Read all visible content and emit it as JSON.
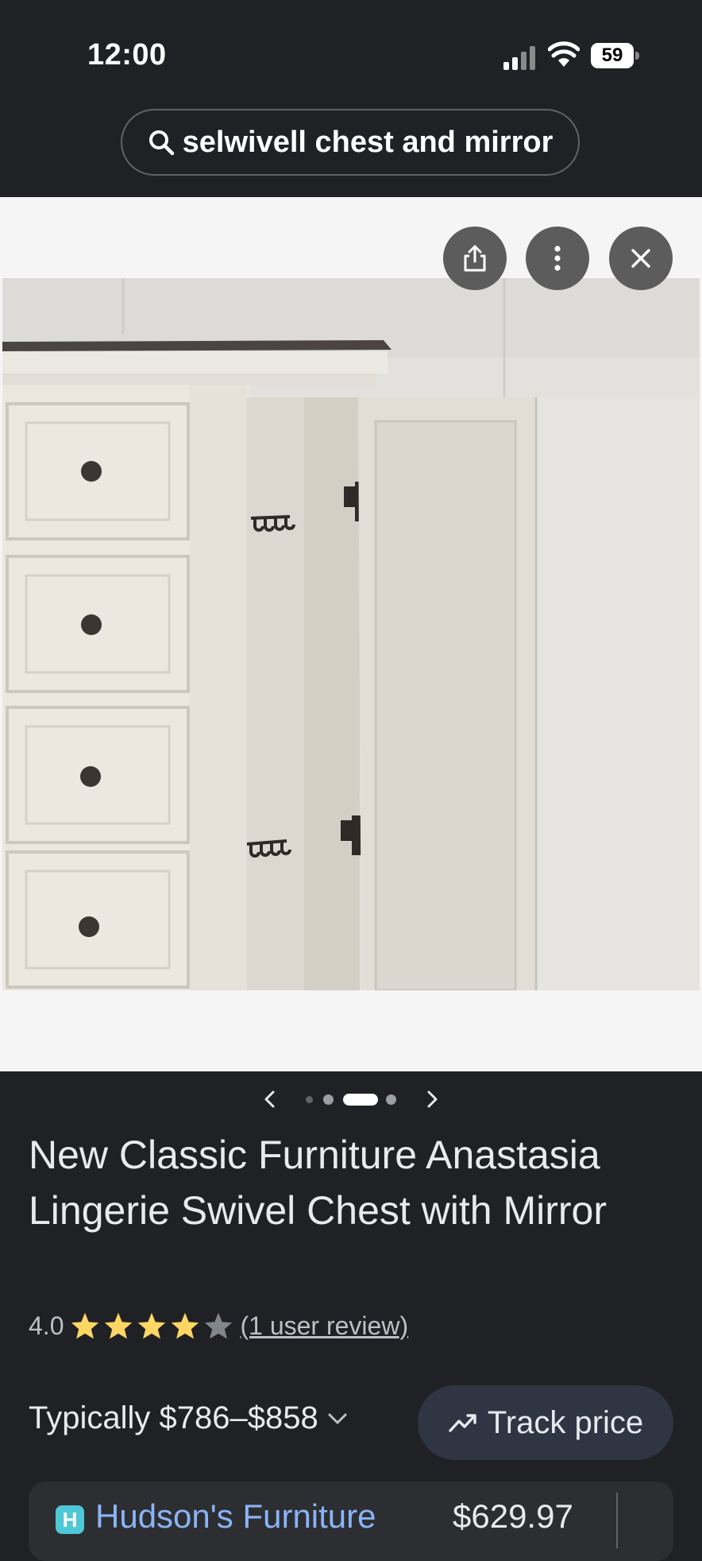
{
  "status_bar": {
    "time": "12:00",
    "battery": "59"
  },
  "search": {
    "query": "selwivell chest and mirror"
  },
  "viewer": {
    "actions": [
      "share-icon",
      "more-vert-icon",
      "close-icon"
    ],
    "carousel": {
      "total": 5,
      "current": 3
    }
  },
  "product": {
    "title": "New Classic Furniture Anastasia Lingerie Swivel Chest with Mirror",
    "rating_value": "4.0",
    "rating_stars": 4,
    "review_link": "(1 user review)",
    "typically": "Typically $786–$858",
    "track_price": "Track price"
  },
  "store": {
    "name": "Hudson's Furniture",
    "price": "$629.97",
    "logo_letter": "H"
  },
  "colors": {
    "background": "#202124",
    "star": "#fdd663",
    "link": "#8ab4f8",
    "chip": "#303544"
  }
}
